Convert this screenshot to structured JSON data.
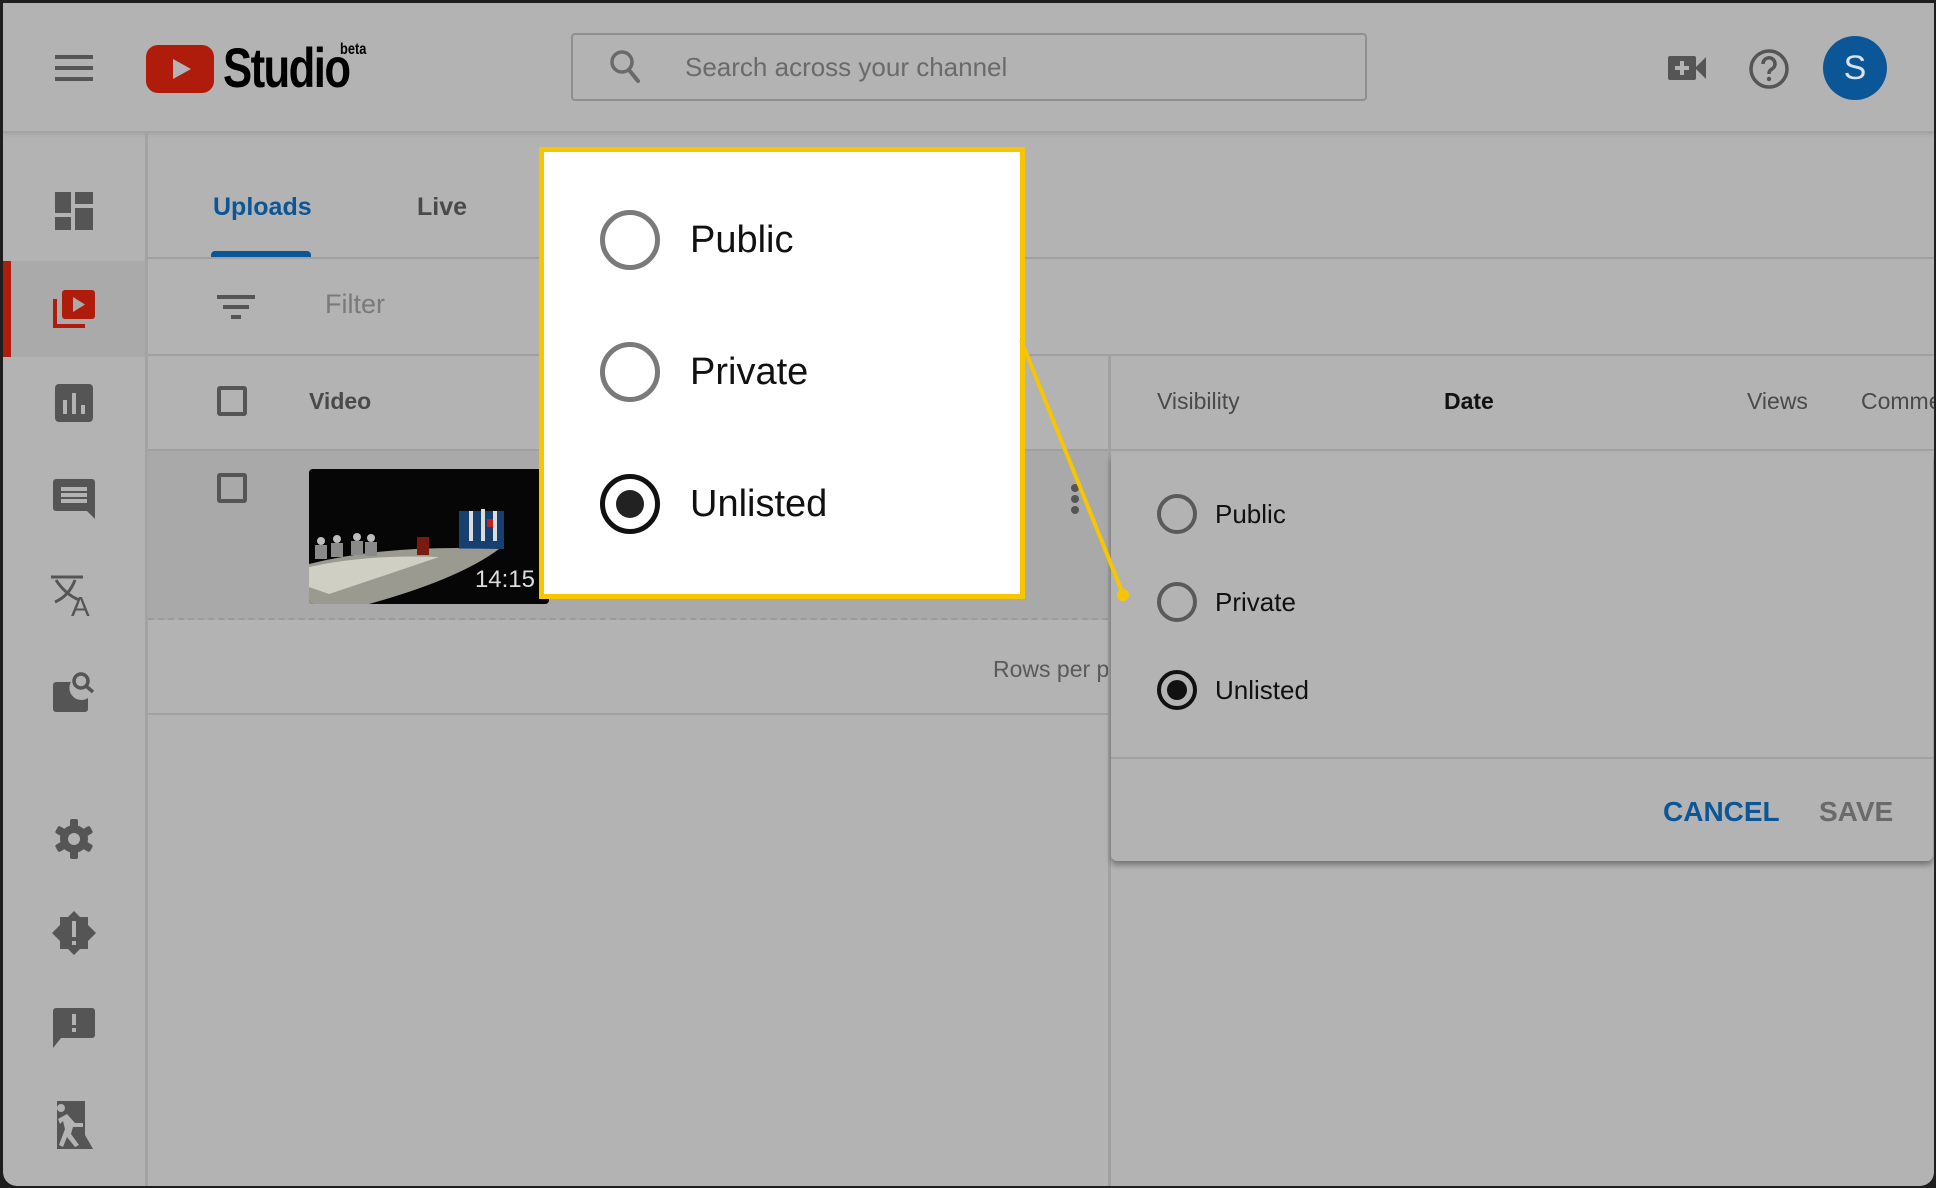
{
  "app": {
    "title": "Studio",
    "badge": "beta"
  },
  "header": {
    "search_placeholder": "Search across your channel",
    "avatar_letter": "S",
    "icons": [
      "menu-icon",
      "youtube-logo-icon",
      "search-icon",
      "create-video-icon",
      "help-icon"
    ]
  },
  "sidebar": {
    "items": [
      {
        "name": "dashboard",
        "icon": "dashboard-icon",
        "active": false
      },
      {
        "name": "videos",
        "icon": "video-library-icon",
        "active": true
      },
      {
        "name": "analytics",
        "icon": "analytics-icon",
        "active": false
      },
      {
        "name": "comments",
        "icon": "comments-icon",
        "active": false
      },
      {
        "name": "translations",
        "icon": "translate-icon",
        "active": false
      },
      {
        "name": "copyright",
        "icon": "copyright-search-icon",
        "active": false
      },
      {
        "name": "settings",
        "icon": "gear-icon",
        "active": false
      },
      {
        "name": "alerts",
        "icon": "alert-badge-icon",
        "active": false
      },
      {
        "name": "feedback",
        "icon": "feedback-icon",
        "active": false
      },
      {
        "name": "exit",
        "icon": "exit-icon",
        "active": false
      }
    ]
  },
  "tabs": [
    {
      "label": "Uploads",
      "active": true
    },
    {
      "label": "Live",
      "active": false
    }
  ],
  "filter": {
    "placeholder": "Filter"
  },
  "table": {
    "columns": [
      "Video",
      "Visibility",
      "Date",
      "Views",
      "Comme"
    ],
    "sorted_column": "Date",
    "rows": [
      {
        "duration": "14:15",
        "selected": false
      }
    ],
    "footer_label": "Rows per p"
  },
  "visibility_popup": {
    "options": [
      {
        "label": "Public",
        "checked": false
      },
      {
        "label": "Private",
        "checked": false
      },
      {
        "label": "Unlisted",
        "checked": true
      }
    ],
    "cancel_label": "CANCEL",
    "save_label": "SAVE"
  },
  "callout": {
    "options": [
      {
        "label": "Public",
        "checked": false
      },
      {
        "label": "Private",
        "checked": false
      },
      {
        "label": "Unlisted",
        "checked": true
      }
    ],
    "border_color": "#f7c600"
  },
  "colors": {
    "brand_red": "#b01c0c",
    "accent_blue": "#0b5697",
    "highlight_yellow": "#f7c600"
  }
}
